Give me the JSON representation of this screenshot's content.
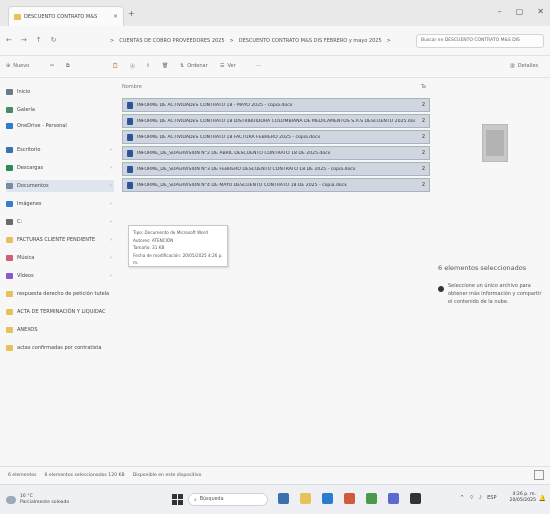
{
  "window": {
    "tab_label": "DESCUENTO CONTRATO M&S",
    "tab_close": "×",
    "new_tab": "+",
    "minimize": "–",
    "maximize": "▢",
    "close": "✕"
  },
  "nav": {
    "back": "←",
    "forward": "→",
    "up": "↑",
    "refresh": "↻",
    "address_parts": [
      "CUENTAS DE COBRO PROVEEDORES 2025",
      "DESCUENTO CONTRATO M&S DIS FEBRERO y mayo 2025"
    ],
    "address_sep": ">",
    "search_placeholder": "Buscar en DESCUENTO CONTRATO M&S DIS"
  },
  "toolbar": {
    "new": "Nuevo",
    "sort": "Ordenar",
    "view": "Ver",
    "more": "···",
    "details": "Detalles"
  },
  "sidebar": {
    "items": [
      {
        "label": "Inicio",
        "icon": "home-icon",
        "color": "#6a7a8a",
        "pinned": false,
        "selected": false
      },
      {
        "label": "Galería",
        "icon": "gallery-icon",
        "color": "#4a8a6a",
        "pinned": false,
        "selected": false
      },
      {
        "label": "OneDrive - Personal",
        "icon": "cloud-icon",
        "color": "#2b7bd0",
        "pinned": false,
        "selected": false
      },
      {
        "label": "Escritorio",
        "icon": "desktop-icon",
        "color": "#3a6fb0",
        "pinned": true,
        "selected": false
      },
      {
        "label": "Descargas",
        "icon": "download-icon",
        "color": "#2a8a5a",
        "pinned": true,
        "selected": false
      },
      {
        "label": "Documentos",
        "icon": "documents-icon",
        "color": "#7a8aa0",
        "pinned": true,
        "selected": true
      },
      {
        "label": "Imágenes",
        "icon": "pictures-icon",
        "color": "#3a7ad0",
        "pinned": true,
        "selected": false
      },
      {
        "label": "C:",
        "icon": "drive-icon",
        "color": "#6a6a6a",
        "pinned": true,
        "selected": false
      },
      {
        "label": "FACTURAS CLIENTE PENDIENTE",
        "icon": "folder-icon",
        "color": "#e6c35a",
        "pinned": true,
        "selected": false
      },
      {
        "label": "Música",
        "icon": "music-icon",
        "color": "#d0607a",
        "pinned": true,
        "selected": false
      },
      {
        "label": "Vídeos",
        "icon": "videos-icon",
        "color": "#8a5ad0",
        "pinned": true,
        "selected": false
      },
      {
        "label": "respuesta derecho de petición tutela",
        "icon": "folder-icon",
        "color": "#e6c35a",
        "pinned": false,
        "selected": false
      },
      {
        "label": "ACTA DE TERMINACIÓN Y LIQUIDAC",
        "icon": "folder-icon",
        "color": "#e6c35a",
        "pinned": false,
        "selected": false
      },
      {
        "label": "ANEXOS",
        "icon": "folder-icon",
        "color": "#e6c35a",
        "pinned": false,
        "selected": false
      },
      {
        "label": "actas confirmadas por contratista",
        "icon": "folder-icon",
        "color": "#e6c35a",
        "pinned": false,
        "selected": false
      }
    ],
    "pin_glyph": "›"
  },
  "list": {
    "col_name": "Nombre",
    "col_size": "Ta",
    "files": [
      {
        "name": "INFORME DE ACTIVIDADES CONTRATO 18 - MAYO 2025 - copia.docx",
        "size": "2"
      },
      {
        "name": "INFORME DE ACTIVIDADES CONTRATO 18 DISTRIBUIDORA COLOMBIANA DE MEDICAMENTOS S.A.S DESCUENTO 2025.docx",
        "size": "2"
      },
      {
        "name": "INFORME DE ACTIVIDADES CONTRATO 18 FACTURA FEBRERO 2025 - copia.docx",
        "size": "2"
      },
      {
        "name": "INFORME_DE_SUPERVISION N°2 DE ABRIL DESCUENTO CONTRATO 18 DE 2025.docx",
        "size": "2"
      },
      {
        "name": "INFORME_DE_SUPERVISION N°3 DE FEBRERO DESCUENTO CONTRATO 18 DE 2025 - copia.docx",
        "size": "2"
      },
      {
        "name": "INFORME_DE_SUPERVISION N°4 DE MAYO DESCUENTO CONTRATO 18 DE 2025 - copia.docx",
        "size": "2"
      }
    ]
  },
  "tooltip": {
    "lines": [
      "Tipo: Documento de Microsoft Word",
      "Autores: ATENCIÓN",
      "Tamaño: 31 KB",
      "Fecha de modificación: 20/05/2025 4:26 p. m."
    ]
  },
  "details": {
    "selected_count": "6 elementos seleccionados",
    "info_text": "Seleccione un único archivo para obtener más información y compartir el contenido de la nube."
  },
  "status": {
    "count": "6 elementos",
    "selected": "6 elementos seleccionados 120 KB",
    "sync": "Disponible en este dispositivo"
  },
  "taskbar": {
    "weather_temp": "16 °C",
    "weather_desc": "Parcialmente soleado",
    "search_placeholder": "Búsqueda",
    "tray_chevron": "^",
    "tray_lang": "ESP",
    "time": "4:26 p. m.",
    "date": "20/05/2025",
    "bell": "🔔",
    "app_colors": [
      "#3a6fb0",
      "#e6c35a",
      "#2b7bd0",
      "#d05a3a",
      "#4a9a4a",
      "#5a6ad0",
      "#333333"
    ]
  }
}
